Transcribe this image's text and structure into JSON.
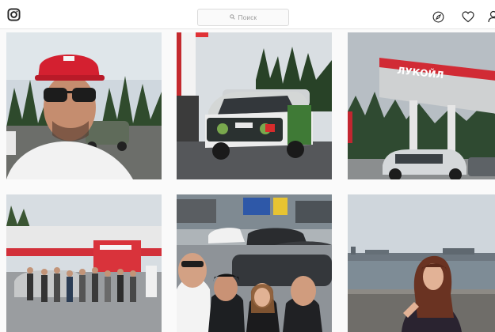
{
  "header": {
    "logo_icon": "instagram-camera-icon",
    "search": {
      "placeholder": "Поиск",
      "icon": "search-icon"
    },
    "nav_icons": [
      "explore-compass-icon",
      "heart-icon",
      "profile-icon"
    ]
  },
  "posts": [
    {
      "id": "post-1",
      "subject": "selfie-man-red-cap"
    },
    {
      "id": "post-2",
      "subject": "rally-car-at-gas-station"
    },
    {
      "id": "post-3",
      "subject": "lukoil-gas-station-canopy",
      "sign_text": "ЛУКОЙЛ"
    },
    {
      "id": "post-4",
      "subject": "group-photo-at-station"
    },
    {
      "id": "post-5",
      "subject": "group-selfie-with-cars"
    },
    {
      "id": "post-6",
      "subject": "woman-by-river-embankment"
    }
  ],
  "colors": {
    "background": "#fafafa",
    "header_bg": "#ffffff",
    "border": "#dbdbdb",
    "lukoil_red": "#d61f2a"
  }
}
